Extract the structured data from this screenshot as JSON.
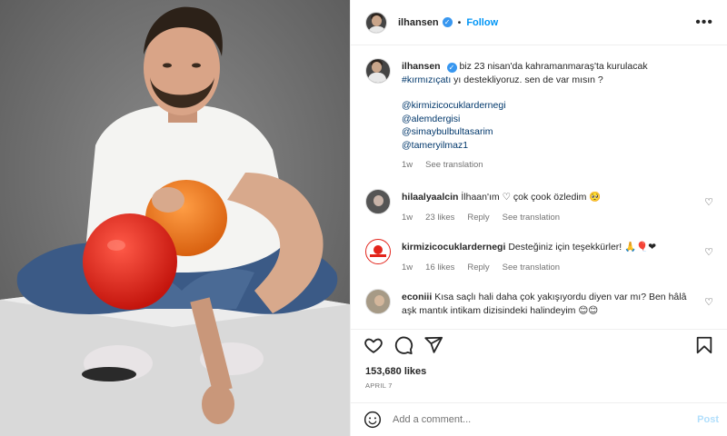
{
  "post": {
    "username": "ilhansen",
    "follow_label": "Follow",
    "dot": "•",
    "more": "•••"
  },
  "caption": {
    "username": "ilhansen",
    "line1": "biz 23 nisan'da kahramanmaraş'ta kurulacak",
    "hashtag": "#kırmızıçatı",
    "line2": " yı destekliyoruz. sen de var mısın ?",
    "mentions": [
      "@kirmizicocuklardernegi",
      "@alemdergisi",
      "@simaybulbultasarim",
      "@tameryilmaz1"
    ],
    "time": "1w",
    "see_translation": "See translation"
  },
  "comments": [
    {
      "username": "hilaalyaalcin",
      "text": "İlhaan'ım ♡ çok çook özledim 🥺",
      "time": "1w",
      "likes": "23 likes",
      "reply": "Reply",
      "see_translation": "See translation"
    },
    {
      "username": "kirmizicocuklardernegi",
      "text": "Desteğiniz için teşekkürler! 🙏🎈❤",
      "time": "1w",
      "likes": "16 likes",
      "reply": "Reply",
      "see_translation": "See translation"
    },
    {
      "username": "econiii",
      "text": "Kısa saçlı hali daha çok yakışıyordu diyen var mı? Ben hâlâ aşk mantık intikam dizisindeki halindeyim 😊😊"
    }
  ],
  "stats": {
    "likes": "153,680 likes",
    "date": "APRIL 7"
  },
  "add_comment": {
    "placeholder": "Add a comment...",
    "post_label": "Post"
  },
  "colors": {
    "accent": "#0095f6",
    "verified": "#3897f0",
    "balloon_red": "#e3241b",
    "balloon_orange": "#f07a1e"
  }
}
